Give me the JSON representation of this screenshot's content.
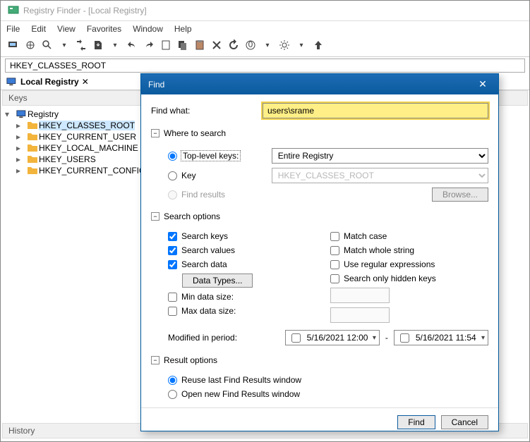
{
  "app": {
    "title": "Registry Finder - [Local Registry]"
  },
  "menu": {
    "file": "File",
    "edit": "Edit",
    "view": "View",
    "favorites": "Favorites",
    "window": "Window",
    "help": "Help"
  },
  "address": {
    "value": "HKEY_CLASSES_ROOT"
  },
  "tab": {
    "label": "Local Registry"
  },
  "panels": {
    "keys": "Keys",
    "history": "History"
  },
  "tree": {
    "root": "Registry",
    "items": [
      "HKEY_CLASSES_ROOT",
      "HKEY_CURRENT_USER",
      "HKEY_LOCAL_MACHINE",
      "HKEY_USERS",
      "HKEY_CURRENT_CONFIG"
    ]
  },
  "dialog": {
    "title": "Find",
    "find_what_label": "Find what:",
    "find_what_value": "users\\srame",
    "groups": {
      "where": "Where to search",
      "options": "Search options",
      "result": "Result options"
    },
    "where": {
      "toplevel": "Top-level keys:",
      "key": "Key",
      "find_results": "Find results",
      "scope": {
        "options": [
          "Entire Registry"
        ],
        "selected": "Entire Registry"
      },
      "key_select": {
        "options": [
          "HKEY_CLASSES_ROOT"
        ],
        "selected": "HKEY_CLASSES_ROOT"
      },
      "browse": "Browse..."
    },
    "options": {
      "search_keys": "Search keys",
      "search_values": "Search values",
      "search_data": "Search data",
      "data_types": "Data Types...",
      "min_size": "Min data size:",
      "max_size": "Max data size:",
      "match_case": "Match case",
      "match_whole": "Match whole string",
      "regex": "Use regular expressions",
      "hidden": "Search only hidden keys"
    },
    "modified": {
      "label": "Modified in period:",
      "from": "5/16/2021 12:00",
      "to": "5/16/2021 11:54",
      "dash": "-"
    },
    "result": {
      "reuse": "Reuse last Find Results window",
      "open_new": "Open new Find Results window"
    },
    "buttons": {
      "find": "Find",
      "cancel": "Cancel"
    }
  }
}
